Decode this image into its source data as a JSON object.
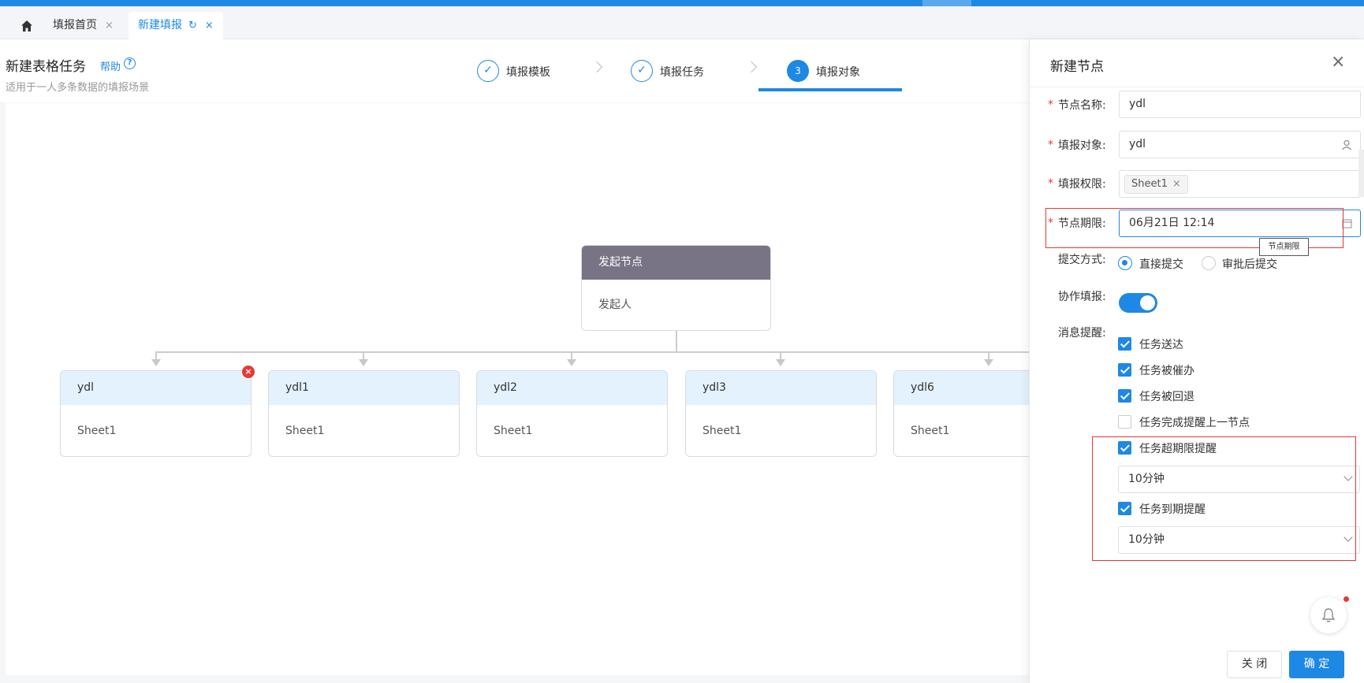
{
  "tabs": {
    "home_label": "",
    "items": [
      {
        "label": "填报首页",
        "close": "×"
      },
      {
        "label": "新建填报",
        "refresh": "↻",
        "close": "×"
      }
    ]
  },
  "header": {
    "title": "新建表格任务",
    "help": "帮助",
    "help_icon": "?",
    "subtitle": "适用于一人多条数据的填报场景"
  },
  "steps": [
    {
      "icon": "✓",
      "label": "填报模板"
    },
    {
      "icon": "✓",
      "label": "填报任务"
    },
    {
      "icon": "3",
      "label": "填报对象"
    }
  ],
  "flow": {
    "root": {
      "title": "发起节点",
      "body": "发起人"
    },
    "remove_badge": "×",
    "children": [
      {
        "title": "ydl",
        "body": "Sheet1"
      },
      {
        "title": "ydl1",
        "body": "Sheet1"
      },
      {
        "title": "ydl2",
        "body": "Sheet1"
      },
      {
        "title": "ydl3",
        "body": "Sheet1"
      },
      {
        "title": "ydl6",
        "body": "Sheet1"
      }
    ]
  },
  "drawer": {
    "title": "新建节点",
    "close_icon": "×",
    "required_mark": "*",
    "node_name_label": "节点名称:",
    "node_name_value": "ydl",
    "target_label": "填报对象:",
    "target_value": "ydl",
    "permission_label": "填报权限:",
    "permission_tag": "Sheet1",
    "permission_tag_close": "×",
    "deadline_label": "节点期限:",
    "deadline_value": "06月21日 12:14",
    "deadline_tooltip": "节点期限",
    "submit_label": "提交方式:",
    "submit_options": [
      "直接提交",
      "审批后提交"
    ],
    "submit_selected": 0,
    "collab_label": "协作填报:",
    "collab_on": true,
    "notify_label": "消息提醒:",
    "notify_items": [
      {
        "label": "任务送达",
        "checked": true
      },
      {
        "label": "任务被催办",
        "checked": true
      },
      {
        "label": "任务被回退",
        "checked": true
      },
      {
        "label": "任务完成提醒上一节点",
        "checked": false
      },
      {
        "label": "任务超期限提醒",
        "checked": true
      },
      {
        "label": "任务到期提醒",
        "checked": true
      }
    ],
    "overdue_select": "10分钟",
    "due_select": "10分钟",
    "close_button": "关 闭",
    "ok_button": "确 定"
  },
  "colors": {
    "accent": "#1e88e5",
    "root_header": "#787385",
    "child_header": "#e3f2fc",
    "highlight_red": "#e53935"
  }
}
